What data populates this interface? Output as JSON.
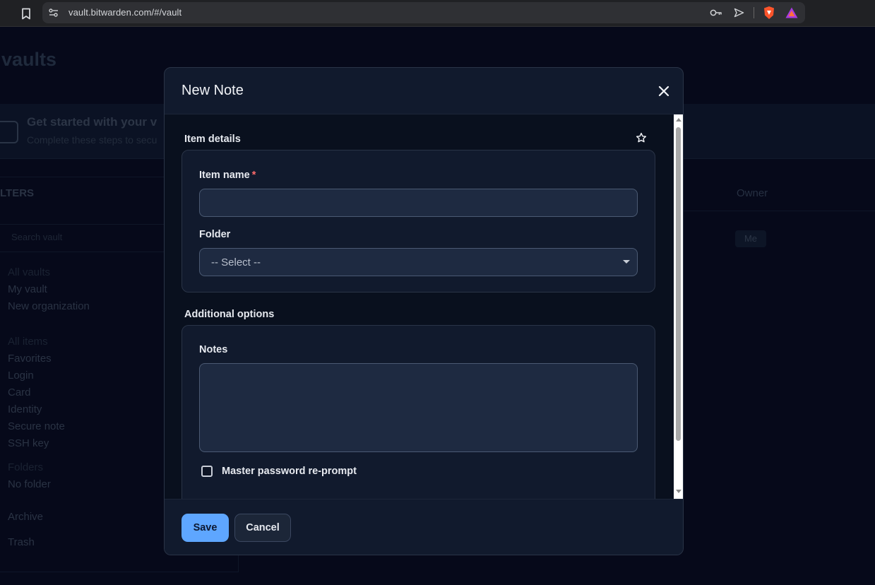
{
  "browser": {
    "url": "vault.bitwarden.com/#/vault"
  },
  "background": {
    "page_title": "vaults",
    "banner_title": "Get started with your v",
    "banner_subtitle": "Complete these steps to secu",
    "filters_title": "LTERS",
    "search_placeholder": "Search vault",
    "vault_items": [
      "All vaults",
      "My vault",
      "New organization"
    ],
    "type_items": [
      "All items",
      "Favorites",
      "Login",
      "Card",
      "Identity",
      "Secure note",
      "SSH key"
    ],
    "folder_items": [
      "Folders",
      "No folder"
    ],
    "archive": "Archive",
    "trash": "Trash",
    "owner_header": "Owner",
    "owner_badge": "Me"
  },
  "dialog": {
    "title": "New Note",
    "item_details_title": "Item details",
    "item_name_label": "Item name",
    "item_name_required": "*",
    "item_name_value": "",
    "folder_label": "Folder",
    "folder_selected": "-- Select --",
    "additional_options_title": "Additional options",
    "notes_label": "Notes",
    "notes_value": "",
    "reprompt_label": "Master password re-prompt",
    "reprompt_checked": false,
    "save_label": "Save",
    "cancel_label": "Cancel"
  },
  "colors": {
    "accent": "#5ea6ff",
    "required": "#ff6b6b",
    "dialog_bg": "#111a2d"
  }
}
